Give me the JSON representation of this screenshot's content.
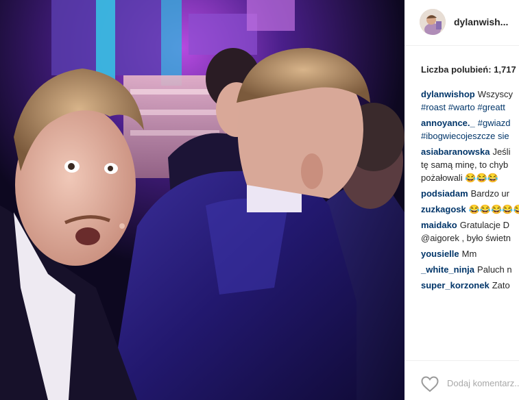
{
  "post": {
    "username": "dylanwish...",
    "likes_label": "Liczba polubień: 1,717"
  },
  "comments": [
    {
      "user": "dylanwishop",
      "lines": [
        "Wszyscy",
        "#roast #warto #greatt"
      ]
    },
    {
      "user": "annoyance._",
      "lines": [
        "#gwiazd",
        "#ibogwiecojeszcze sie"
      ]
    },
    {
      "user": "asiabaranowska",
      "lines": [
        "Jeśli",
        "tę samą minę, to chyb",
        "pożałowali 😂😂😂"
      ]
    },
    {
      "user": "podsiadam",
      "lines": [
        "Bardzo ur"
      ]
    },
    {
      "user": "zuzkagosk",
      "lines": [
        "😂😂😂😂😂"
      ]
    },
    {
      "user": "maidako",
      "lines": [
        "Gratulacje D",
        "@aigorek , było świetn"
      ]
    },
    {
      "user": "yousielle",
      "lines": [
        "Mm"
      ]
    },
    {
      "user": "_white_ninja",
      "lines": [
        "Paluch n"
      ]
    },
    {
      "user": "super_korzonek",
      "lines": [
        "Zato"
      ]
    }
  ],
  "footer": {
    "add_comment_placeholder": "Dodaj komentarz..."
  },
  "icons": {
    "like": "heart-icon"
  },
  "colors": {
    "username": "#262626",
    "comment_user": "#003569",
    "hashtag": "#003569",
    "placeholder": "#a8a8a8"
  }
}
